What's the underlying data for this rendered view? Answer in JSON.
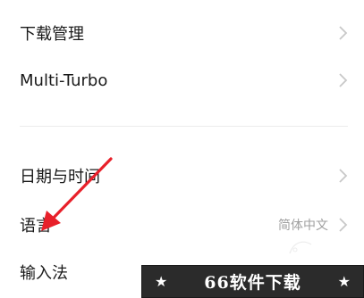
{
  "settings": {
    "rows": [
      {
        "label": "下载管理",
        "value": "",
        "icon": "chevron-right-icon"
      },
      {
        "label": "Multi-Turbo",
        "value": "",
        "icon": "chevron-right-icon"
      },
      {
        "label": "日期与时间",
        "value": "",
        "icon": "chevron-right-icon"
      },
      {
        "label": "语言",
        "value": "简体中文",
        "icon": "chevron-right-icon"
      },
      {
        "label": "输入法",
        "value": "",
        "icon": "chevron-right-icon"
      }
    ]
  },
  "watermark": {
    "text": "66软件下载",
    "star": "★"
  },
  "annotation": {
    "icon": "red-arrow-icon",
    "color": "#e8202a"
  },
  "colors": {
    "text": "#1a1a1a",
    "secondary_text": "#a0a0a0",
    "chevron": "#c8c8c8",
    "divider": "#ececec",
    "watermark_bg": "#2b2b2b"
  }
}
